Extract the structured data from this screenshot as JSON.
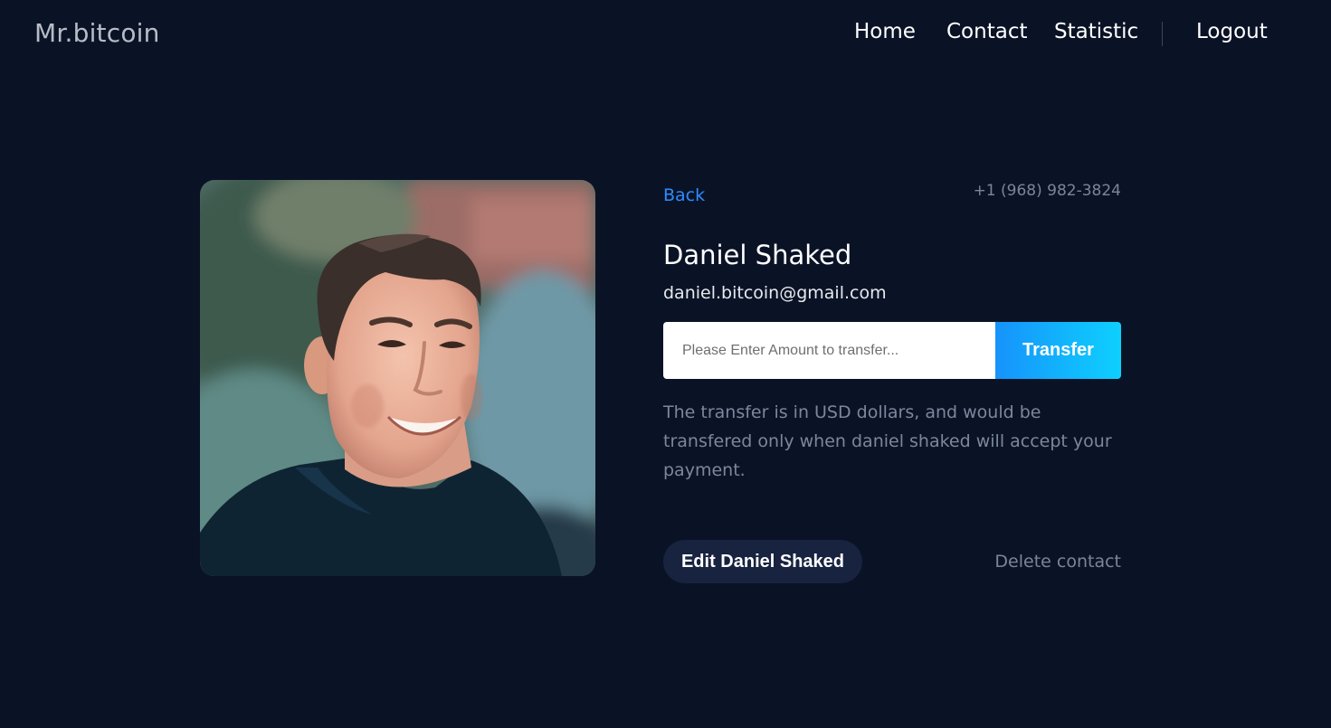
{
  "header": {
    "logo": "Mr.bitcoin",
    "nav": {
      "home": "Home",
      "contact": "Contact",
      "statistic": "Statistic",
      "logout": "Logout"
    }
  },
  "contact": {
    "photo_alt": "Daniel Shaked",
    "back_label": "Back",
    "phone": "+1 (968) 982-3824",
    "name": "Daniel Shaked",
    "email": "daniel.bitcoin@gmail.com"
  },
  "transfer": {
    "placeholder": "Please Enter Amount to transfer...",
    "button_label": "Transfer",
    "note": "The transfer is in USD dollars, and would be transfered only when daniel shaked will accept your payment."
  },
  "actions": {
    "edit_label": "Edit Daniel Shaked",
    "delete_label": "Delete contact"
  },
  "colors": {
    "background": "#0a1326",
    "accent_link": "#2e8bff",
    "button_gradient_start": "#1693fb",
    "button_gradient_end": "#0ed0fe",
    "edit_button_bg": "#17233f"
  }
}
